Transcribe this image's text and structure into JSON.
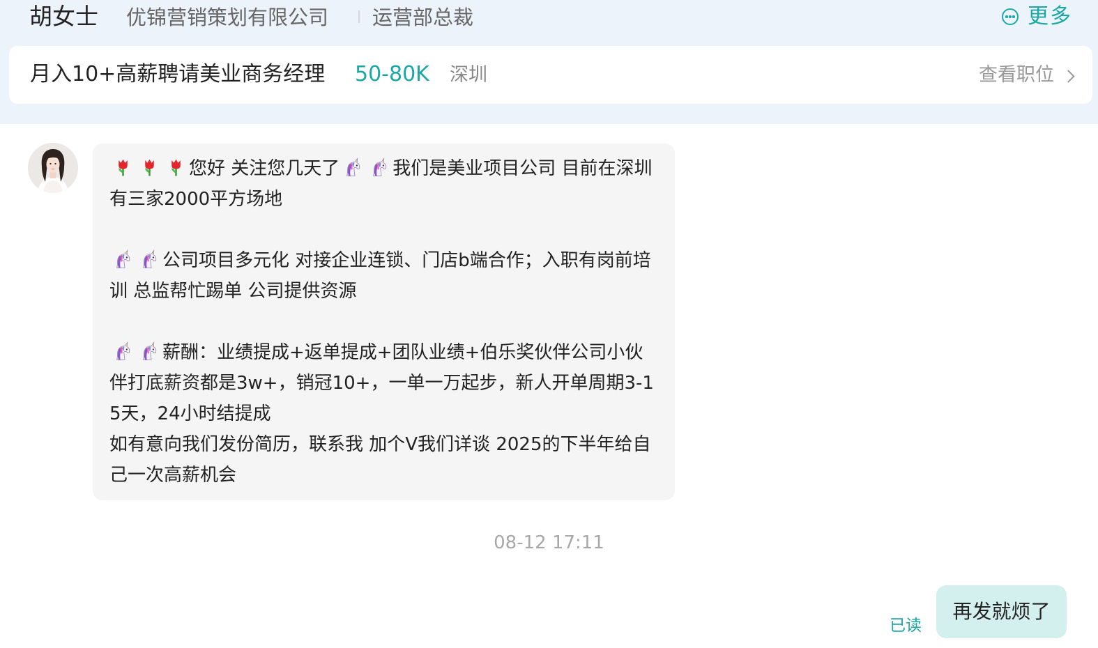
{
  "header": {
    "contact_name": "胡女士",
    "company": "优锦营销策划有限公司",
    "title": "运营部总裁",
    "more_label": "更多",
    "more_icon": "more-circle-icon"
  },
  "job": {
    "title": "月入10+高薪聘请美业商务经理",
    "salary": "50-80K",
    "city": "深圳",
    "view_label": "查看职位",
    "view_icon": "chevron-right-icon"
  },
  "messages": [
    {
      "direction": "incoming",
      "sender_avatar": "avatar",
      "segments": {
        "s1": "您好 关注您几天了",
        "s2": "我们是美业项目公司 目前在深圳有三家2000平方场地\n\n",
        "s3": "公司项目多元化 对接企业连锁、门店b端合作；入职有岗前培训 总监帮忙踢单 公司提供资源\n\n",
        "s4": "薪酬：业绩提成+返单提成+团队业绩+伯乐奖伙伴公司小伙伴打底薪资都是3w+，销冠10+，一单一万起步，新人开单周期3-15天，24小时结提成\n如有意向我们发份简历，联系我 加个V我们详谈 2025的下半年给自己一次高薪机会"
      },
      "emoji_names": [
        "tulip-emoji",
        "unicorn-emoji"
      ]
    },
    {
      "direction": "outgoing",
      "text": "再发就烦了",
      "status": "已读"
    }
  ],
  "timestamp": "08-12 17:11",
  "colors": {
    "accent": "#1aa8a5",
    "header_bg": "#ecf3fa",
    "incoming_bubble": "#f5f5f5",
    "outgoing_bubble": "#d4f0ee"
  }
}
